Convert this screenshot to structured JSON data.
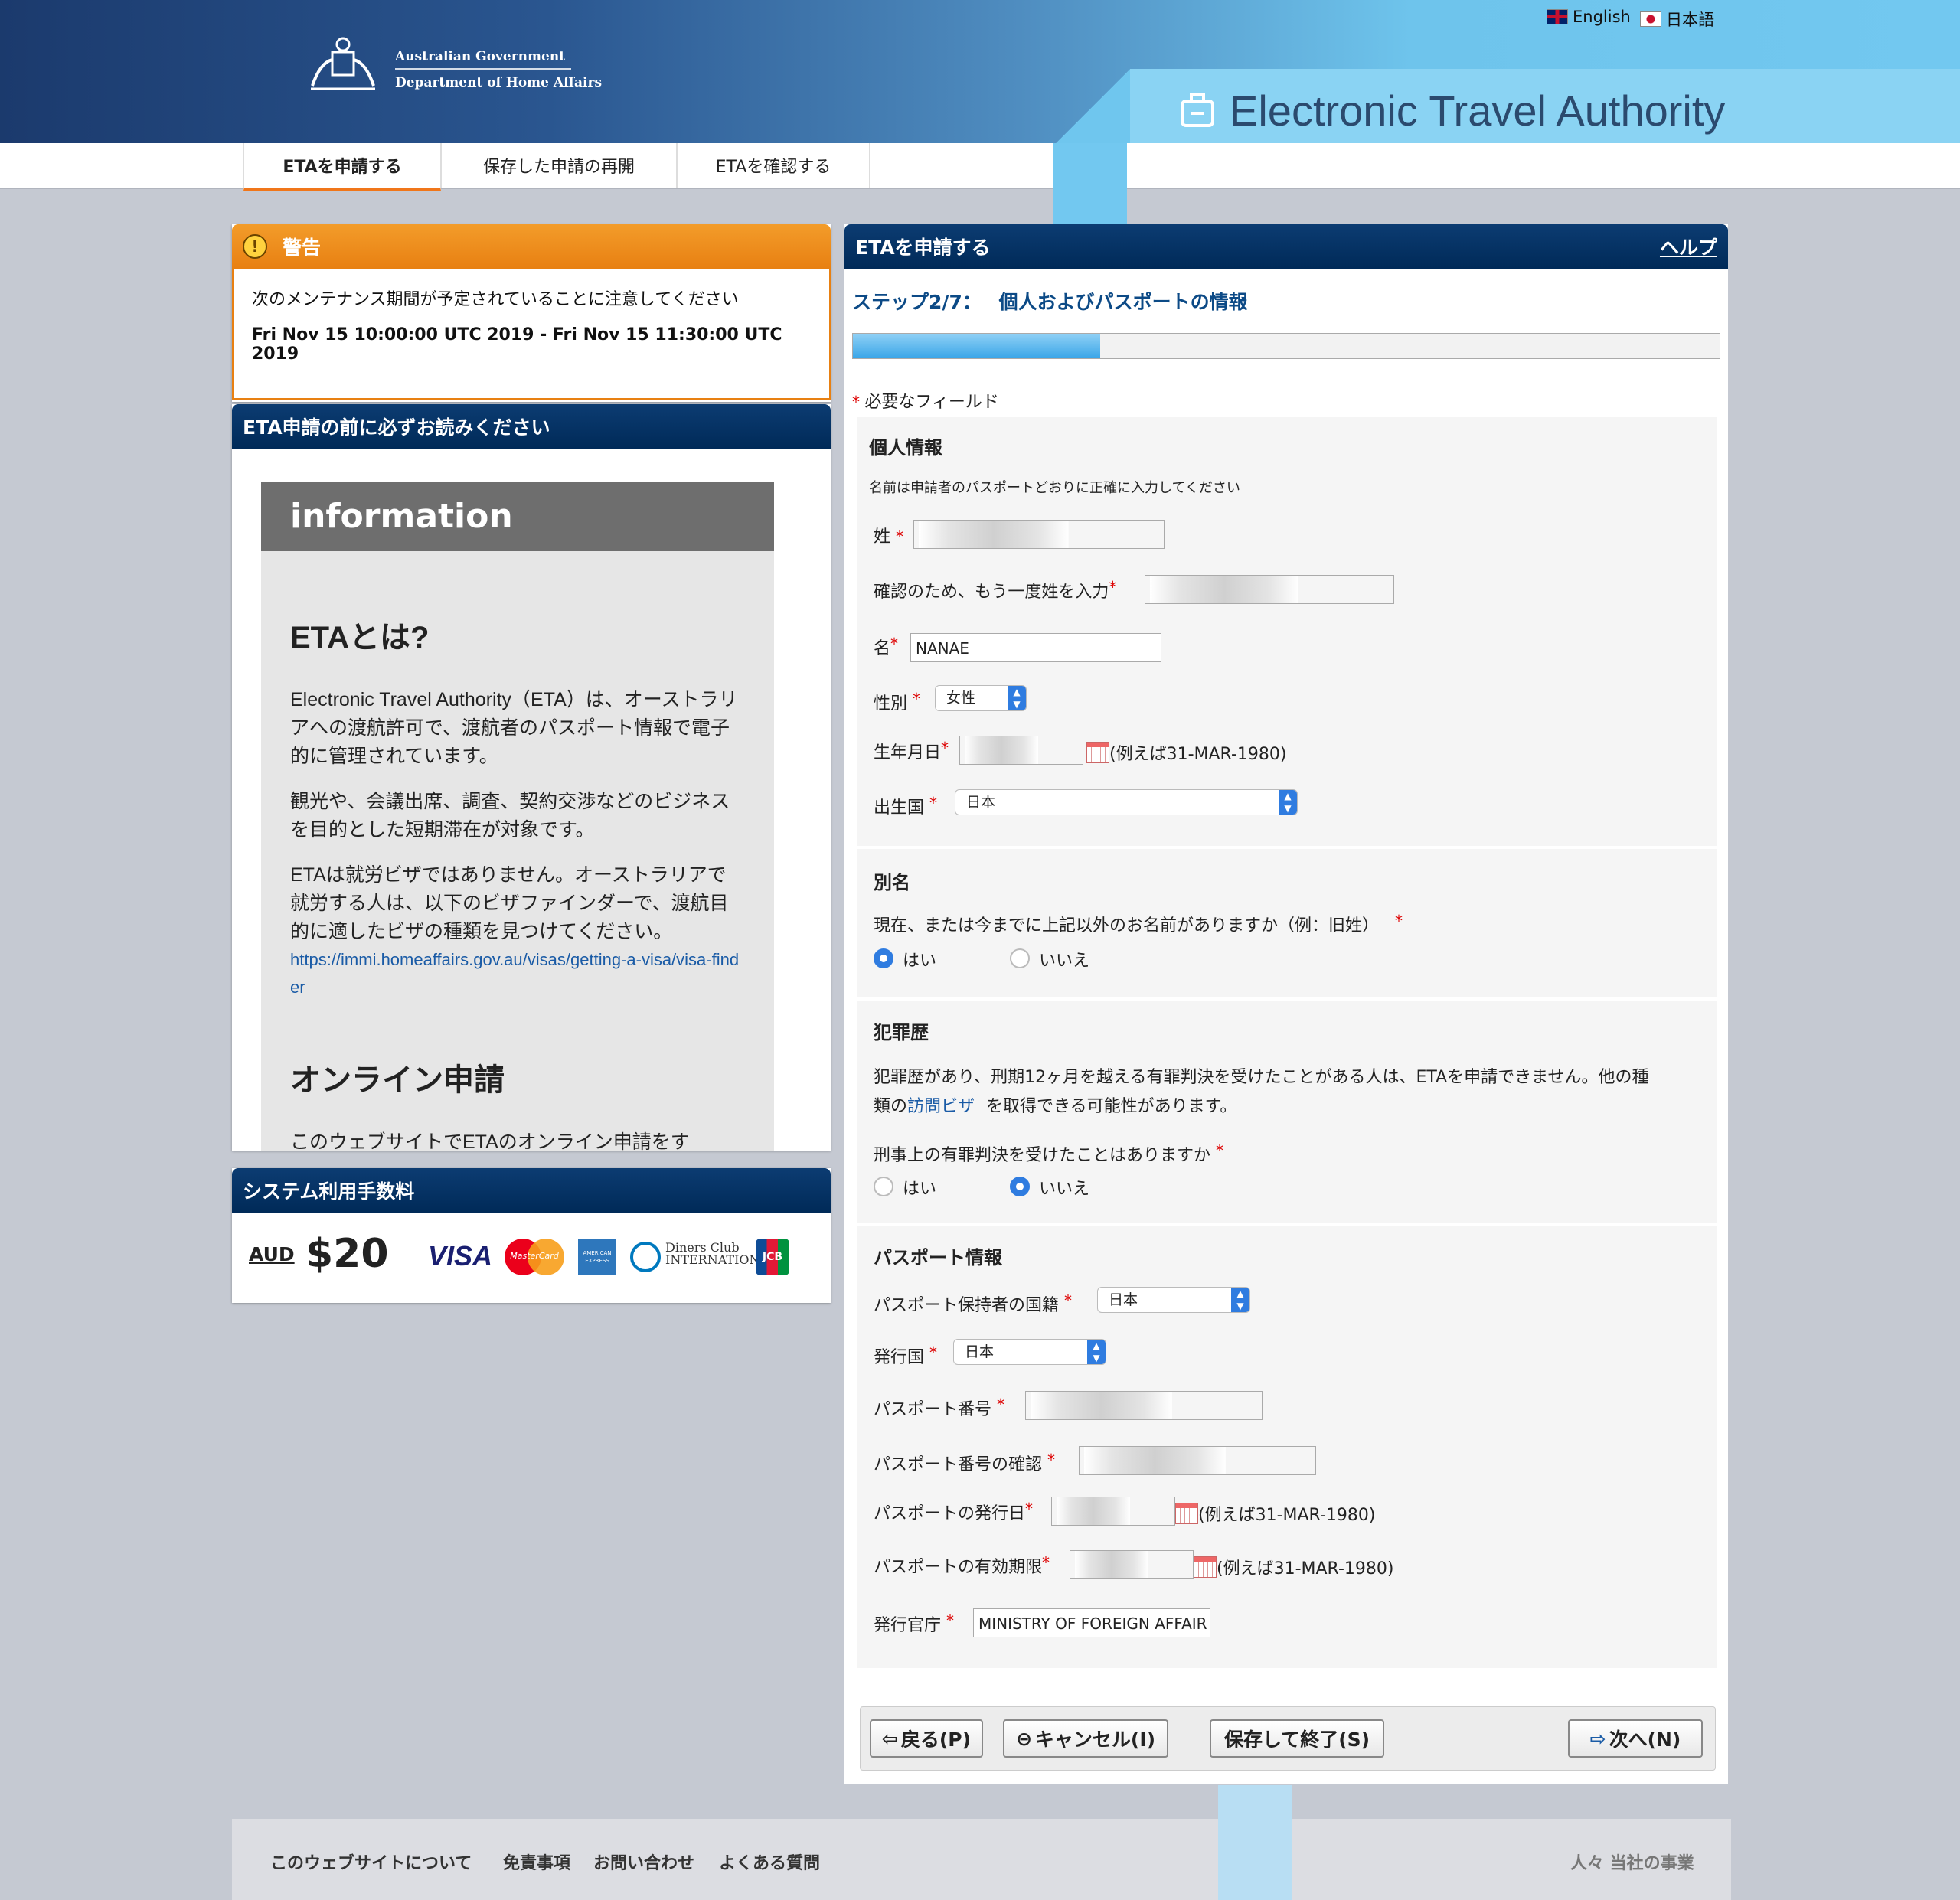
{
  "header": {
    "lang_english": "English",
    "lang_japanese": "日本語",
    "gov_line1": "Australian Government",
    "gov_line2": "Department of Home Affairs",
    "eta_title": "Electronic Travel Authority"
  },
  "nav": {
    "items": [
      {
        "label": "ETAを申請する"
      },
      {
        "label": "保存した申請の再開"
      },
      {
        "label": "ETAを確認する"
      }
    ]
  },
  "warning": {
    "title": "警告",
    "text": "次のメンテナンス期間が予定されていることに注意してください",
    "period": "Fri Nov 15 10:00:00 UTC 2019 - Fri Nov 15 11:30:00 UTC 2019"
  },
  "info_panel": {
    "title": "ETA申請の前に必ずお読みください",
    "banner": "information",
    "heading1": "ETAとは?",
    "para1": "Electronic Travel Authority（ETA）は、オーストラリアへの渡航許可で、渡航者のパスポート情報で電子的に管理されています。",
    "para2": "観光や、会議出席、調査、契約交渉などのビジネスを目的とした短期滞在が対象です。",
    "para3": "ETAは就労ビザではありません。オーストラリアで就労する人は、以下のビザファインダーで、渡航目的に適したビザの種類を見つけてください。",
    "link": "https://immi.homeaffairs.gov.au/visas/getting-a-visa/visa-finder",
    "heading2": "オンライン申請",
    "para4": "このウェブサイトでETAのオンライン申請をす"
  },
  "fee_panel": {
    "title": "システム利用手数料",
    "currency": "AUD",
    "amount": "$20",
    "cards": [
      "VISA",
      "MasterCard",
      "AMERICAN EXPRESS",
      "Diners Club INTERNATIONAL",
      "JCB"
    ]
  },
  "form": {
    "header": "ETAを申請する",
    "help": "ヘルプ",
    "step": "ステップ2/7：",
    "step_title": "個人およびパスポートの情報",
    "progress": 0.285,
    "required_note": "必要なフィールド",
    "personal": {
      "title": "個人情報",
      "note": "名前は申請者のパスポートどおりに正確に入力してください",
      "surname_label": "姓",
      "surname_confirm_label": "確認のため、もう一度姓を入力",
      "given_label": "名",
      "given_value": "NANAE",
      "sex_label": "性別",
      "sex_value": "女性",
      "dob_label": "生年月日",
      "dob_example": "(例えば31-MAR-1980)",
      "birth_country_label": "出生国",
      "birth_country_value": "日本"
    },
    "alias": {
      "title": "別名",
      "question": "現在、または今までに上記以外のお名前がありますか（例：旧姓）",
      "yes": "はい",
      "no": "いいえ"
    },
    "criminal": {
      "title": "犯罪歴",
      "text1": "犯罪歴があり、刑期12ヶ月を越える有罪判決を受けたことがある人は、ETAを申請できません。他の種",
      "text2a": "類の",
      "text2_link": "訪問ビザ",
      "text2b": "を取得できる可能性があります。",
      "question": "刑事上の有罪判決を受けたことはありますか",
      "yes": "はい",
      "no": "いいえ"
    },
    "passport": {
      "title": "パスポート情報",
      "nationality_label": "パスポート保持者の国籍",
      "nationality_value": "日本",
      "issuing_country_label": "発行国",
      "issuing_country_value": "日本",
      "number_label": "パスポート番号",
      "number_confirm_label": "パスポート番号の確認",
      "issue_date_label": "パスポートの発行日",
      "expiry_label": "パスポートの有効期限",
      "date_example": "(例えば31-MAR-1980)",
      "authority_label": "発行官庁",
      "authority_value": "MINISTRY OF FOREIGN AFFAIR"
    },
    "buttons": {
      "back": "戻る(P)",
      "cancel": "キャンセル(I)",
      "save": "保存して終了(S)",
      "next": "次へ(N)"
    }
  },
  "footer": {
    "links": [
      "このウェブサイトについて",
      "免責事項",
      "お問い合わせ",
      "よくある質問"
    ],
    "right": "人々 当社の事業"
  },
  "colors": {
    "nav_blue": "#0c3c72",
    "accent_orange": "#e88012",
    "link_blue": "#1a5ba6",
    "radio_blue": "#2f7ce0"
  }
}
